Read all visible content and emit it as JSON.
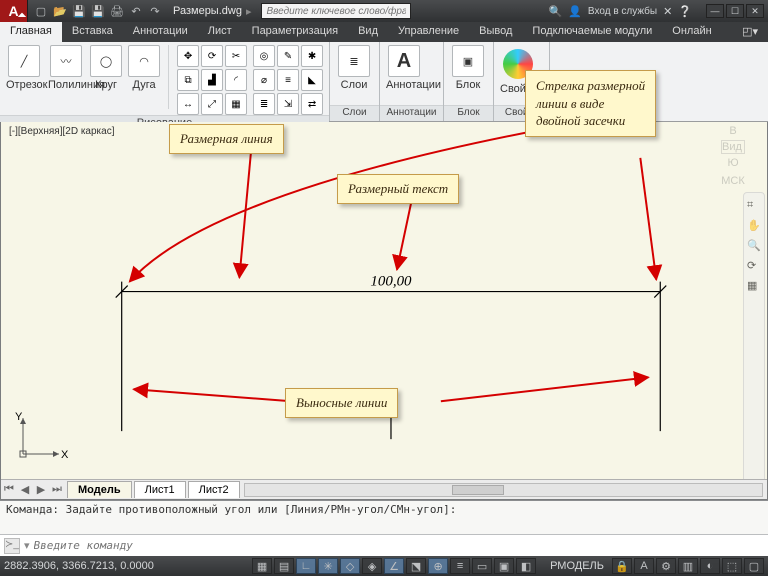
{
  "title": "Размеры.dwg",
  "search_placeholder": "Введите ключевое слово/фразу",
  "login": "Вход в службы",
  "menu": {
    "items": [
      "Главная",
      "Вставка",
      "Аннотации",
      "Лист",
      "Параметризация",
      "Вид",
      "Управление",
      "Вывод",
      "Подключаемые модули",
      "Онлайн"
    ],
    "active": 0
  },
  "ribbon": {
    "draw": {
      "title": "Рисование",
      "btns": [
        {
          "label": "Отрезок"
        },
        {
          "label": "Полилиния"
        },
        {
          "label": "Круг"
        },
        {
          "label": "Дуга"
        }
      ]
    },
    "layers": {
      "title": "Слои",
      "label": "Слои"
    },
    "annot": {
      "title": "Аннотации",
      "label": "Аннотации",
      "glyph": "A"
    },
    "block": {
      "title": "Блок",
      "label": "Блок"
    },
    "props": {
      "title": "Свойст",
      "label": "Свойст"
    }
  },
  "viewport_label": "[-][Верхняя][2D каркас]",
  "viewcube": {
    "face": "Вид",
    "wcs": "МСК"
  },
  "dimension": {
    "text": "100,00"
  },
  "callouts": {
    "dim_line": "Размерная линия",
    "dim_text": "Размерный текст",
    "arrows": "Стрелка размерной\nлинии в виде\nдвойной засечки",
    "ext_lines": "Выносные линии"
  },
  "model_tabs": {
    "items": [
      "Модель",
      "Лист1",
      "Лист2"
    ],
    "active": 0
  },
  "command": {
    "log": "Команда: Задайте противоположный угол или [Линия/РМн-угол/СМн-угол]:",
    "placeholder": "Введите команду"
  },
  "status": {
    "coords": "2882.3906, 3366.7213, 0.0000",
    "model": "РМОДЕЛЬ"
  },
  "ucs": {
    "x": "X",
    "y": "Y"
  }
}
